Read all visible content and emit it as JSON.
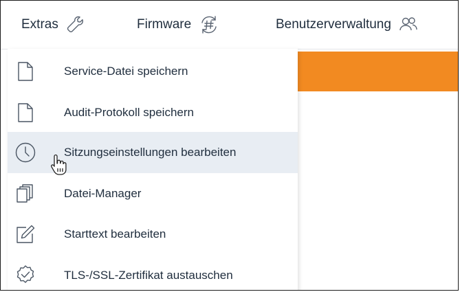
{
  "menubar": {
    "items": [
      {
        "label": "Extras",
        "icon": "wrench-icon"
      },
      {
        "label": "Firmware",
        "icon": "firmware-update-icon"
      },
      {
        "label": "Benutzerverwaltung",
        "icon": "users-icon"
      }
    ]
  },
  "dropdown": {
    "items": [
      {
        "label": "Service-Datei speichern",
        "icon": "document-icon"
      },
      {
        "label": "Audit-Protokoll speichern",
        "icon": "document-icon"
      },
      {
        "label": "Sitzungseinstellungen bearbeiten",
        "icon": "clock-icon",
        "hovered": true
      },
      {
        "label": "Datei-Manager",
        "icon": "files-icon"
      },
      {
        "label": "Starttext bearbeiten",
        "icon": "edit-icon"
      },
      {
        "label": "TLS-/SSL-Zertifikat austauschen",
        "icon": "certificate-icon"
      }
    ]
  },
  "colors": {
    "accent": "#f28a21",
    "hover": "#e8edf3",
    "text": "#1f2d3d"
  }
}
